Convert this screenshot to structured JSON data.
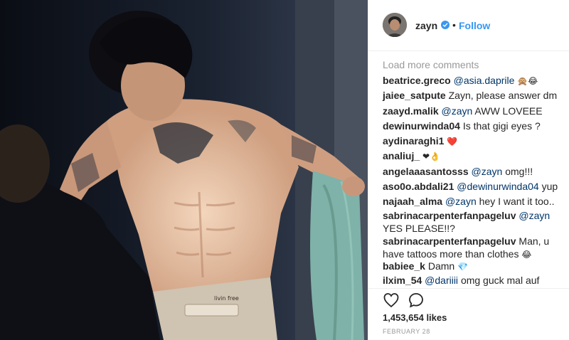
{
  "post": {
    "image_alt": "photo of shirtless tattooed man",
    "image_waistband_text": "livin free"
  },
  "header": {
    "username": "zayn",
    "separator": "•",
    "follow_label": "Follow",
    "verified_icon": "verified-badge-icon",
    "accent_color": "#3897f0"
  },
  "comments": {
    "load_more_label": "Load more comments",
    "items": [
      {
        "user": "beatrice.greco",
        "mention": "@asia.daprile",
        "text": "",
        "emoji": "🙊😂"
      },
      {
        "user": "jaiee_satpute",
        "mention": "",
        "text": "Zayn, please answer dm",
        "emoji": ""
      },
      {
        "user": "zaayd.malik",
        "mention": "@zayn",
        "text": "AWW LOVEEE",
        "emoji": ""
      },
      {
        "user": "dewinurwinda04",
        "mention": "",
        "text": "Is that gigi eyes ?",
        "emoji": ""
      },
      {
        "user": "aydinaraghi1",
        "mention": "",
        "text": "",
        "emoji": "❤️"
      },
      {
        "user": "analiuj_",
        "mention": "",
        "text": "",
        "emoji": "❤👌"
      },
      {
        "user": "angelaaasantosss",
        "mention": "@zayn",
        "text": "omg!!!",
        "emoji": ""
      },
      {
        "user": "aso0o.abdali21",
        "mention": "@dewinurwinda04",
        "text": "yup",
        "emoji": ""
      },
      {
        "user": "najaah_alma",
        "mention": "@zayn",
        "text": "hey I want it too..",
        "emoji": ""
      },
      {
        "user": "sabrinacarpenterfanpageluv",
        "mention": "@zayn",
        "text": "YES PLEASE!!?",
        "emoji": ""
      },
      {
        "user": "sabrinacarpenterfanpageluv",
        "mention": "",
        "text": "Man, u have tattoos more than clothes",
        "emoji": "😂"
      },
      {
        "user": "babiee_k",
        "mention": "",
        "text": "Damn",
        "emoji": "💎"
      },
      {
        "user": "ilxim_54",
        "mention": "@dariiii",
        "text": "omg guck mal auf seine",
        "emoji": ""
      }
    ]
  },
  "actions": {
    "like_icon": "heart-outline-icon",
    "comment_icon": "comment-bubble-icon",
    "likes_text": "1,453,654 likes",
    "date_text": "FEBRUARY 28"
  }
}
